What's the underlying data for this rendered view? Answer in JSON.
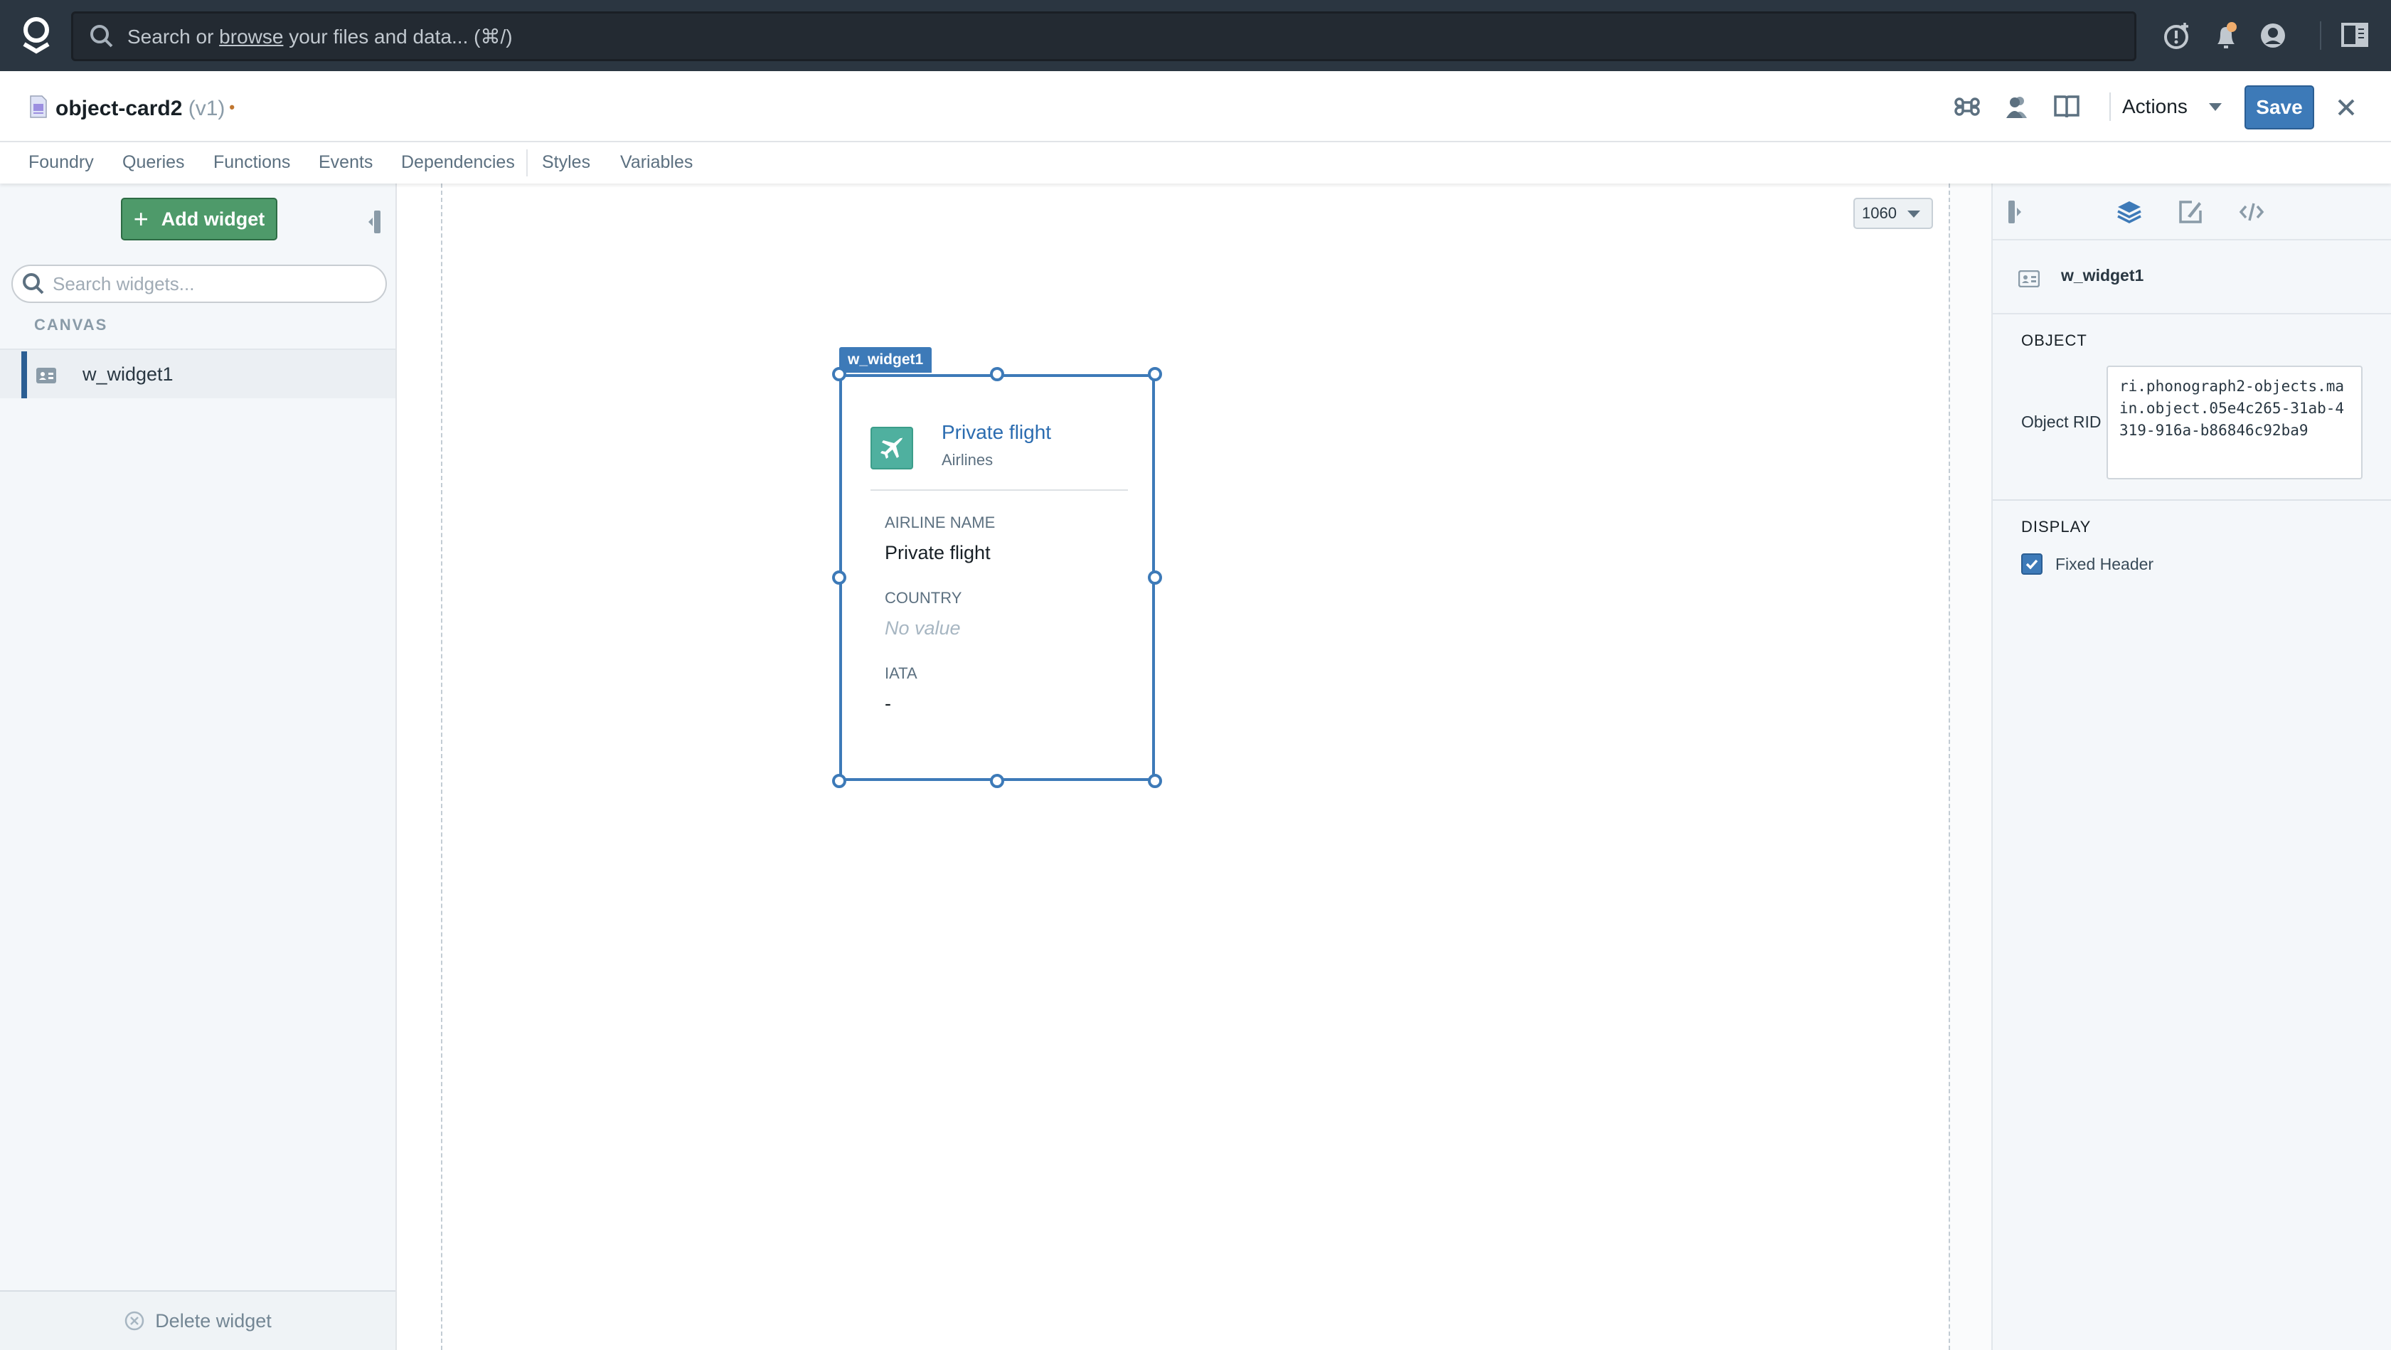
{
  "topbar": {
    "search_prefix": "Search or ",
    "search_link": "browse",
    "search_suffix": " your files and data... (⌘/)",
    "icons": [
      "palantir-logo-icon",
      "search-icon",
      "notification-add-icon",
      "bell-icon",
      "user-icon",
      "sidebar-toggle-icon"
    ]
  },
  "header": {
    "title": "object-card2",
    "version": "(v1)",
    "unsaved_dot": "•",
    "actions_label": "Actions",
    "save_label": "Save"
  },
  "tabs": [
    {
      "label": "Foundry"
    },
    {
      "label": "Queries"
    },
    {
      "label": "Functions"
    },
    {
      "label": "Events"
    },
    {
      "label": "Dependencies"
    },
    {
      "label": "Styles"
    },
    {
      "label": "Variables"
    }
  ],
  "sidebar": {
    "add_widget_label": "Add widget",
    "search_placeholder": "Search widgets...",
    "section_label": "CANVAS",
    "items": [
      {
        "label": "w_widget1",
        "selected": true
      }
    ],
    "delete_label": "Delete widget"
  },
  "canvas": {
    "width_value": "1060",
    "widget": {
      "tag": "w_widget1",
      "title": "Private flight",
      "subtitle": "Airlines",
      "properties": [
        {
          "label": "AIRLINE NAME",
          "value": "Private flight",
          "empty": false
        },
        {
          "label": "COUNTRY",
          "value": "No value",
          "empty": true
        },
        {
          "label": "IATA",
          "value": "-",
          "empty": false
        }
      ]
    }
  },
  "right_panel": {
    "widget_name": "w_widget1",
    "object_section": "OBJECT",
    "object_rid_label": "Object RID",
    "object_rid_value": "ri.phonograph2-objects.main.object.05e4c265-31ab-4319-916a-b86846c92ba9",
    "display_section": "DISPLAY",
    "fixed_header_label": "Fixed Header",
    "fixed_header_checked": true
  },
  "colors": {
    "topbar_bg": "#2b3641",
    "primary": "#3d7ab8",
    "success": "#4e9a6a",
    "object_icon": "#4fb09f",
    "unsaved": "#c0762f"
  }
}
